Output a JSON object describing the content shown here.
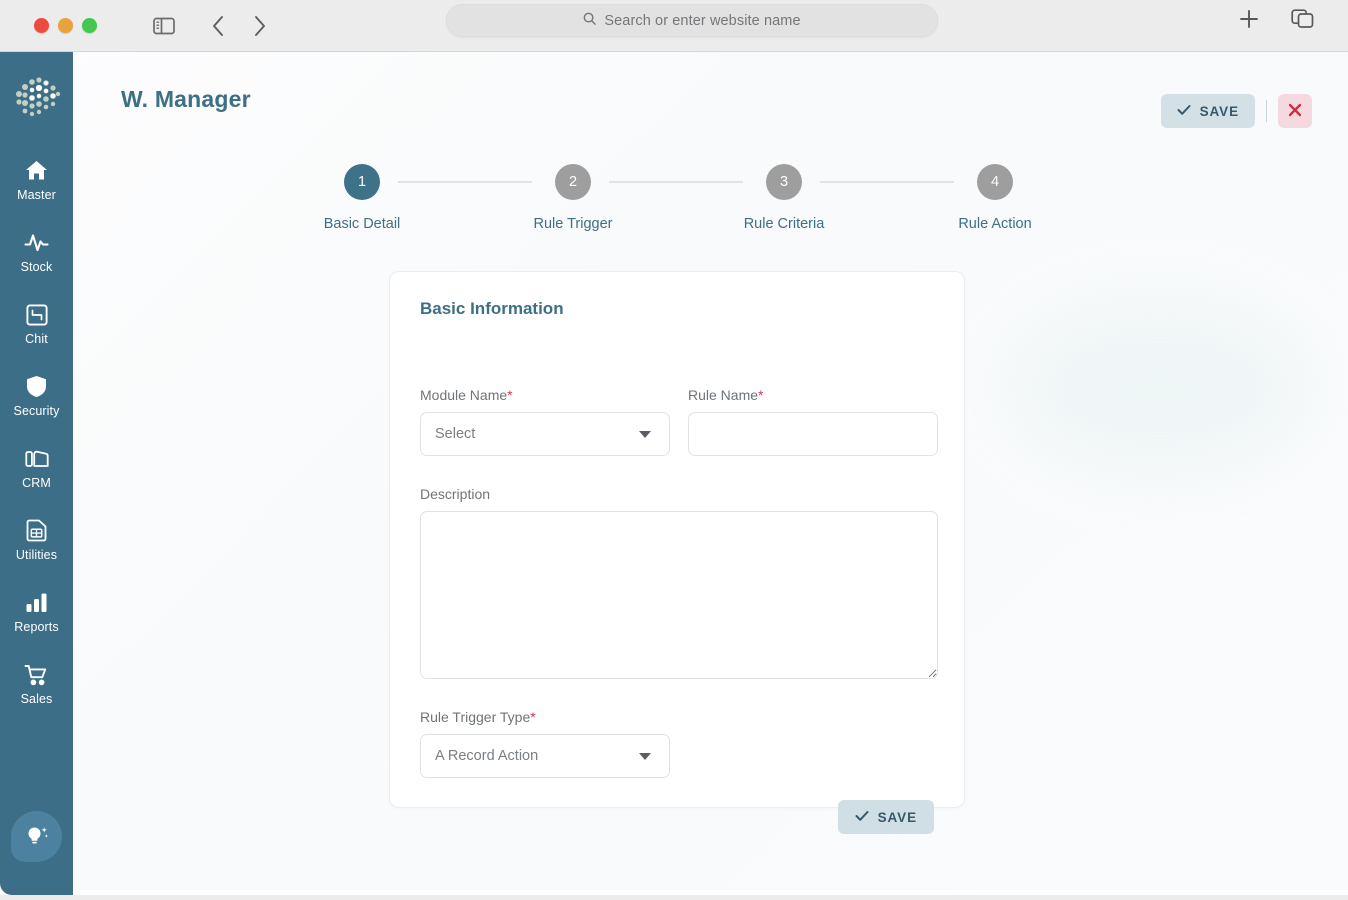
{
  "browser": {
    "traffic_lights": [
      "close",
      "minimize",
      "maximize"
    ],
    "sidebar_toggle_icon": "sidebar-icon",
    "back_icon": "chevron-left-icon",
    "forward_icon": "chevron-right-icon",
    "url_placeholder": "Search or enter website name",
    "search_icon": "search-icon",
    "new_tab_icon": "plus-icon",
    "tab_overview_icon": "tab-overview-icon"
  },
  "sidebar": {
    "logo": "brain-dots-logo",
    "items": [
      {
        "label": "Master",
        "icon": "home-icon"
      },
      {
        "label": "Stock",
        "icon": "pulse-icon"
      },
      {
        "label": "Chit",
        "icon": "crop-square-icon"
      },
      {
        "label": "Security",
        "icon": "shield-icon"
      },
      {
        "label": "CRM",
        "icon": "contact-card-icon"
      },
      {
        "label": "Utilities",
        "icon": "sim-card-icon"
      },
      {
        "label": "Reports",
        "icon": "bar-chart-icon"
      },
      {
        "label": "Sales",
        "icon": "shopping-cart-icon"
      }
    ],
    "assistant_fab_icon": "lightbulb-sparkle-icon"
  },
  "header": {
    "title": "W. Manager",
    "save_label": "SAVE",
    "save_icon": "check-icon",
    "close_icon": "close-x-icon"
  },
  "stepper": {
    "current": 1,
    "steps": [
      {
        "number": "1",
        "label": "Basic Detail",
        "state": "active"
      },
      {
        "number": "2",
        "label": "Rule Trigger",
        "state": "idle"
      },
      {
        "number": "3",
        "label": "Rule Criteria",
        "state": "idle"
      },
      {
        "number": "4",
        "label": "Rule Action",
        "state": "idle"
      }
    ]
  },
  "form": {
    "section_title": "Basic Information",
    "module_name": {
      "label": "Module Name",
      "required": "*",
      "value": "Select"
    },
    "rule_name": {
      "label": "Rule Name",
      "required": "*",
      "value": ""
    },
    "description": {
      "label": "Description",
      "value": ""
    },
    "rule_trigger_type": {
      "label": "Rule Trigger Type",
      "required": "*",
      "value": "A Record Action"
    },
    "save_label": "SAVE",
    "save_icon": "check-icon"
  },
  "colors": {
    "sidebar": "#3c6e88",
    "accent": "#3d6f85",
    "step_active": "#3d7289",
    "step_idle": "#9e9e9e",
    "save_bg": "#d3e1e7",
    "close_bg": "#f6d9de",
    "close_fg": "#cf2b46",
    "required": "#d33a52"
  }
}
